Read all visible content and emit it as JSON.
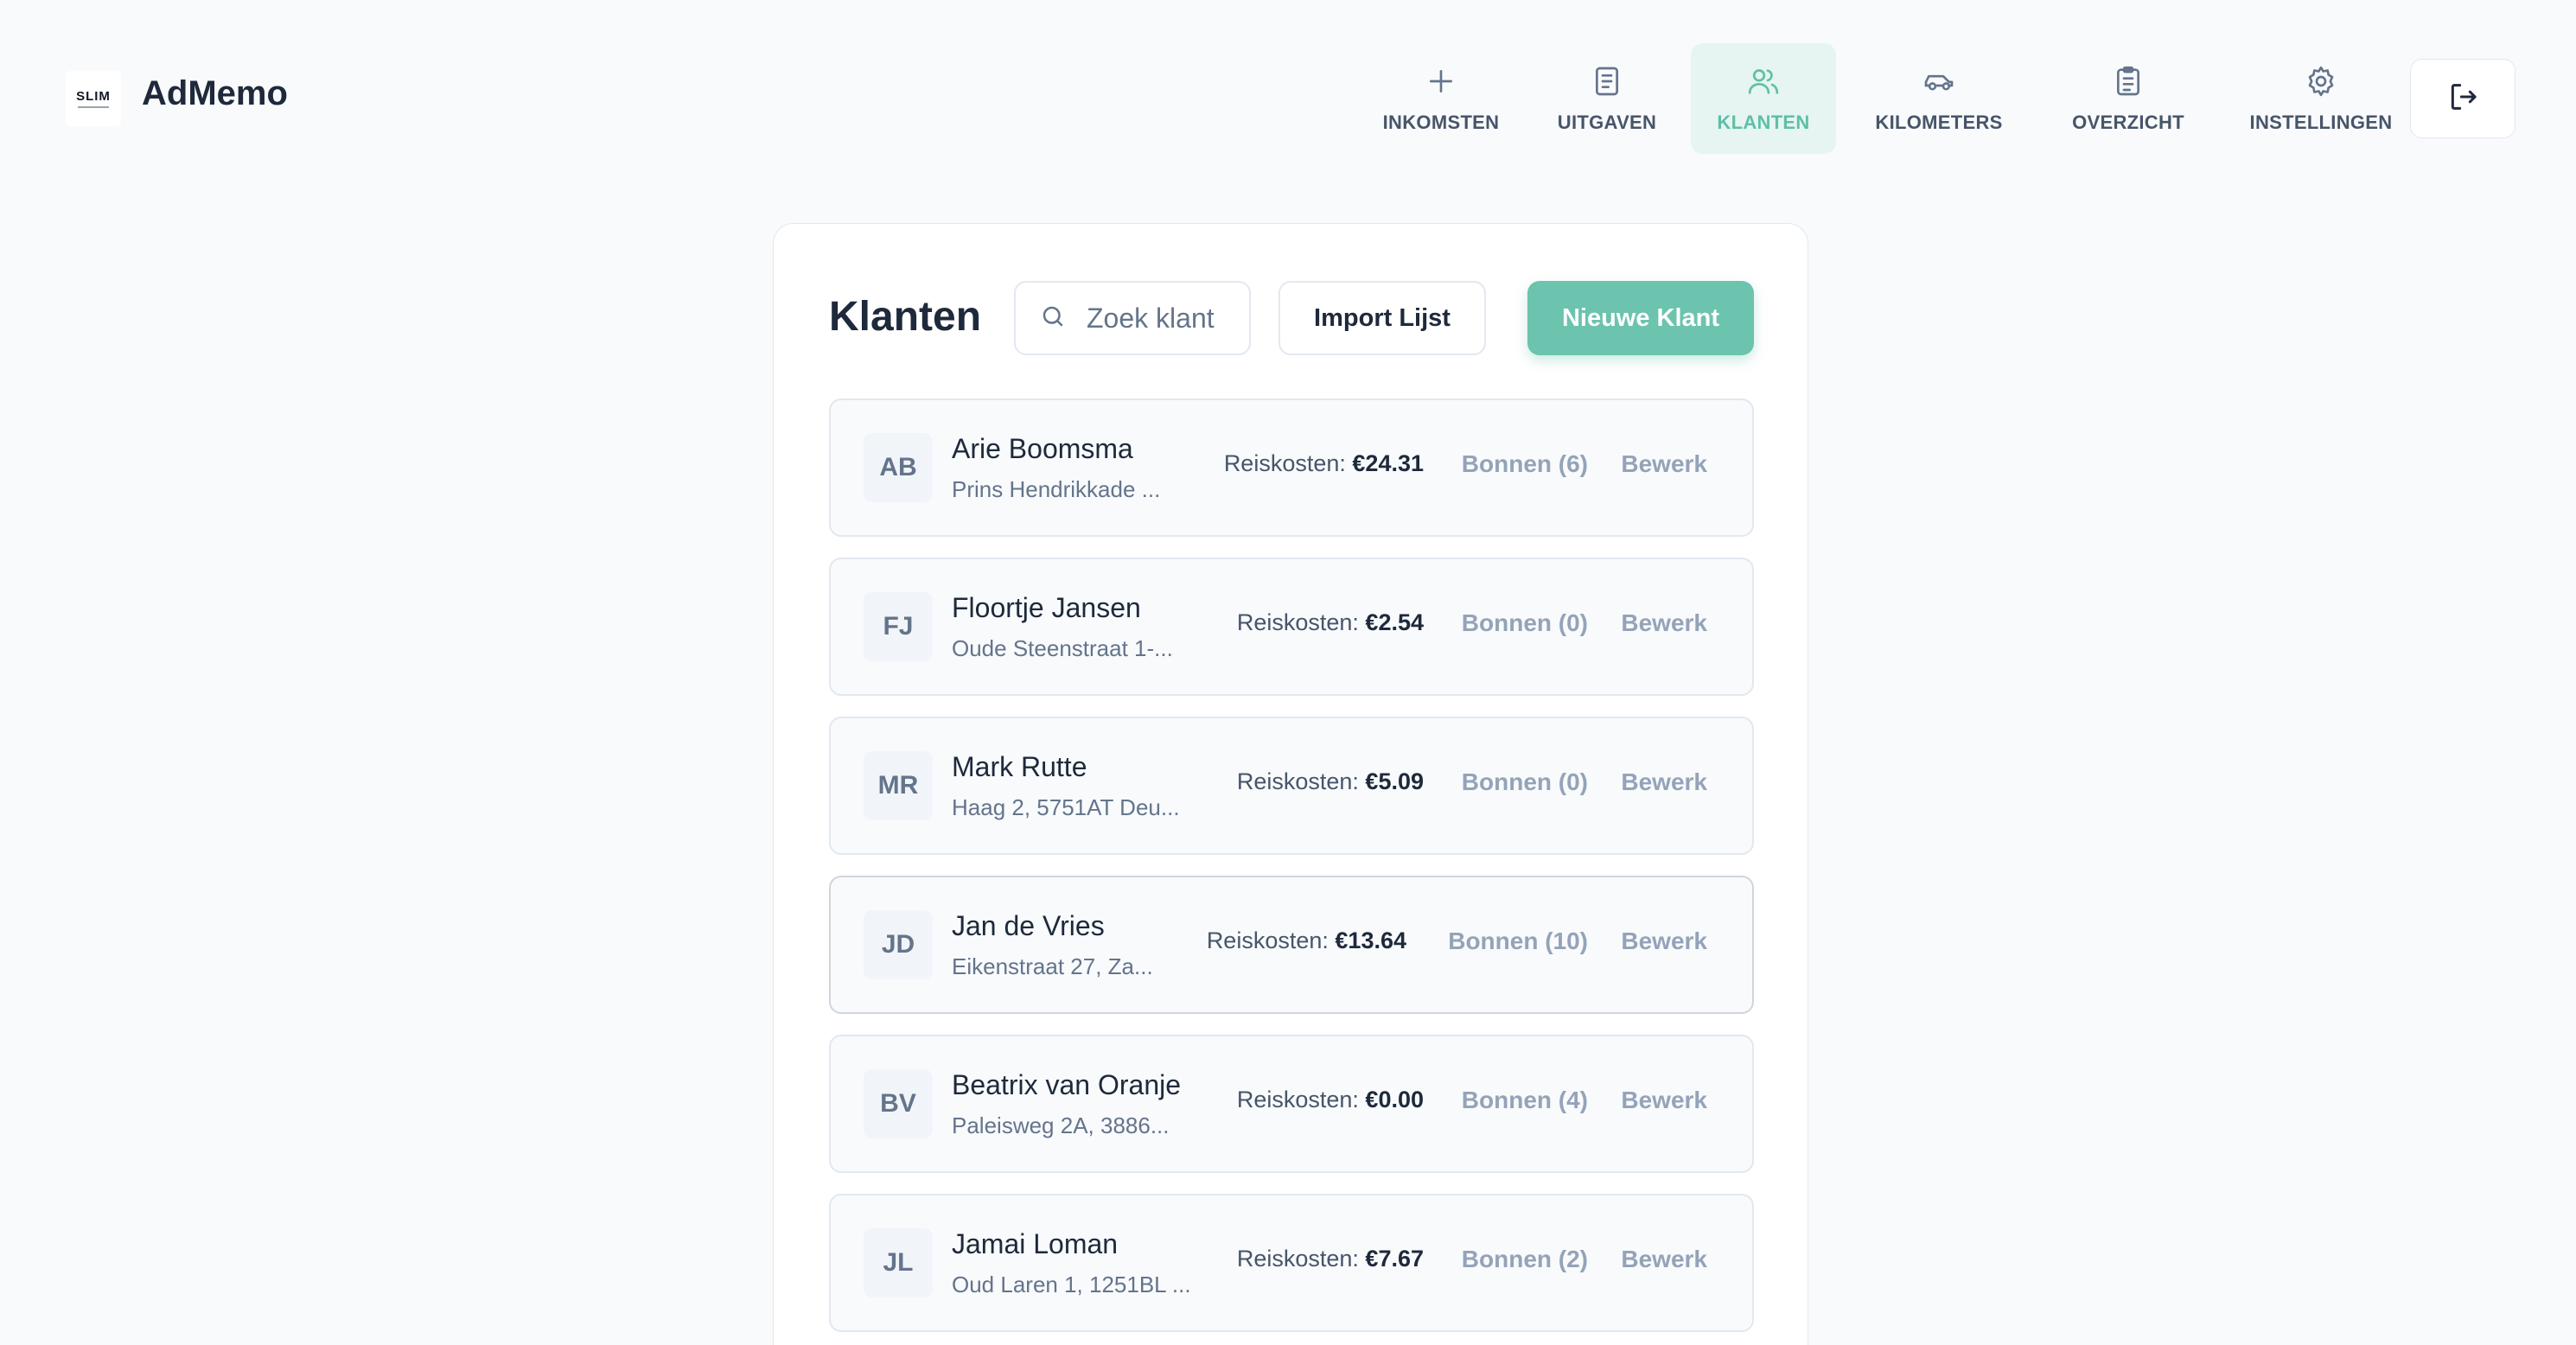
{
  "app": {
    "brand": "AdMemo",
    "logo_text": "SLIM"
  },
  "nav": [
    {
      "label": "INKOMSTEN",
      "icon": "plus-icon",
      "active": false
    },
    {
      "label": "UITGAVEN",
      "icon": "receipt-icon",
      "active": false
    },
    {
      "label": "KLANTEN",
      "icon": "users-icon",
      "active": true
    },
    {
      "label": "KILOMETERS",
      "icon": "car-icon",
      "active": false
    },
    {
      "label": "OVERZICHT",
      "icon": "clipboard-icon",
      "active": false
    },
    {
      "label": "INSTELLINGEN",
      "icon": "gear-icon",
      "active": false
    }
  ],
  "logout_icon": "logout-icon",
  "colors": {
    "accent": "#6cc3ae",
    "accent_light": "#e6f5f1",
    "text_dark": "#1e293b",
    "muted": "#94a3b8"
  },
  "page": {
    "title": "Klanten",
    "search_placeholder": "Zoek klant",
    "import_label": "Import Lijst",
    "new_label": "Nieuwe Klant"
  },
  "clients": [
    {
      "initials": "AB",
      "name": "Arie Boomsma",
      "address": "Prins Hendrikkade ...",
      "cost_label": "Reiskosten:",
      "cost": "€24.31",
      "bonnen": "Bonnen (6)",
      "edit": "Bewerk"
    },
    {
      "initials": "FJ",
      "name": "Floortje Jansen",
      "address": "Oude Steenstraat 1-...",
      "cost_label": "Reiskosten:",
      "cost": "€2.54",
      "bonnen": "Bonnen (0)",
      "edit": "Bewerk"
    },
    {
      "initials": "MR",
      "name": "Mark Rutte",
      "address": "Haag 2, 5751AT Deu...",
      "cost_label": "Reiskosten:",
      "cost": "€5.09",
      "bonnen": "Bonnen (0)",
      "edit": "Bewerk"
    },
    {
      "initials": "JD",
      "name": "Jan de Vries",
      "address": "Eikenstraat 27, Za...",
      "cost_label": "Reiskosten:",
      "cost": "€13.64",
      "bonnen": "Bonnen (10)",
      "edit": "Bewerk"
    },
    {
      "initials": "BV",
      "name": "Beatrix van Oranje",
      "address": "Paleisweg 2A, 3886...",
      "cost_label": "Reiskosten:",
      "cost": "€0.00",
      "bonnen": "Bonnen (4)",
      "edit": "Bewerk"
    },
    {
      "initials": "JL",
      "name": "Jamai Loman",
      "address": "Oud Laren 1, 1251BL ...",
      "cost_label": "Reiskosten:",
      "cost": "€7.67",
      "bonnen": "Bonnen (2)",
      "edit": "Bewerk"
    }
  ]
}
